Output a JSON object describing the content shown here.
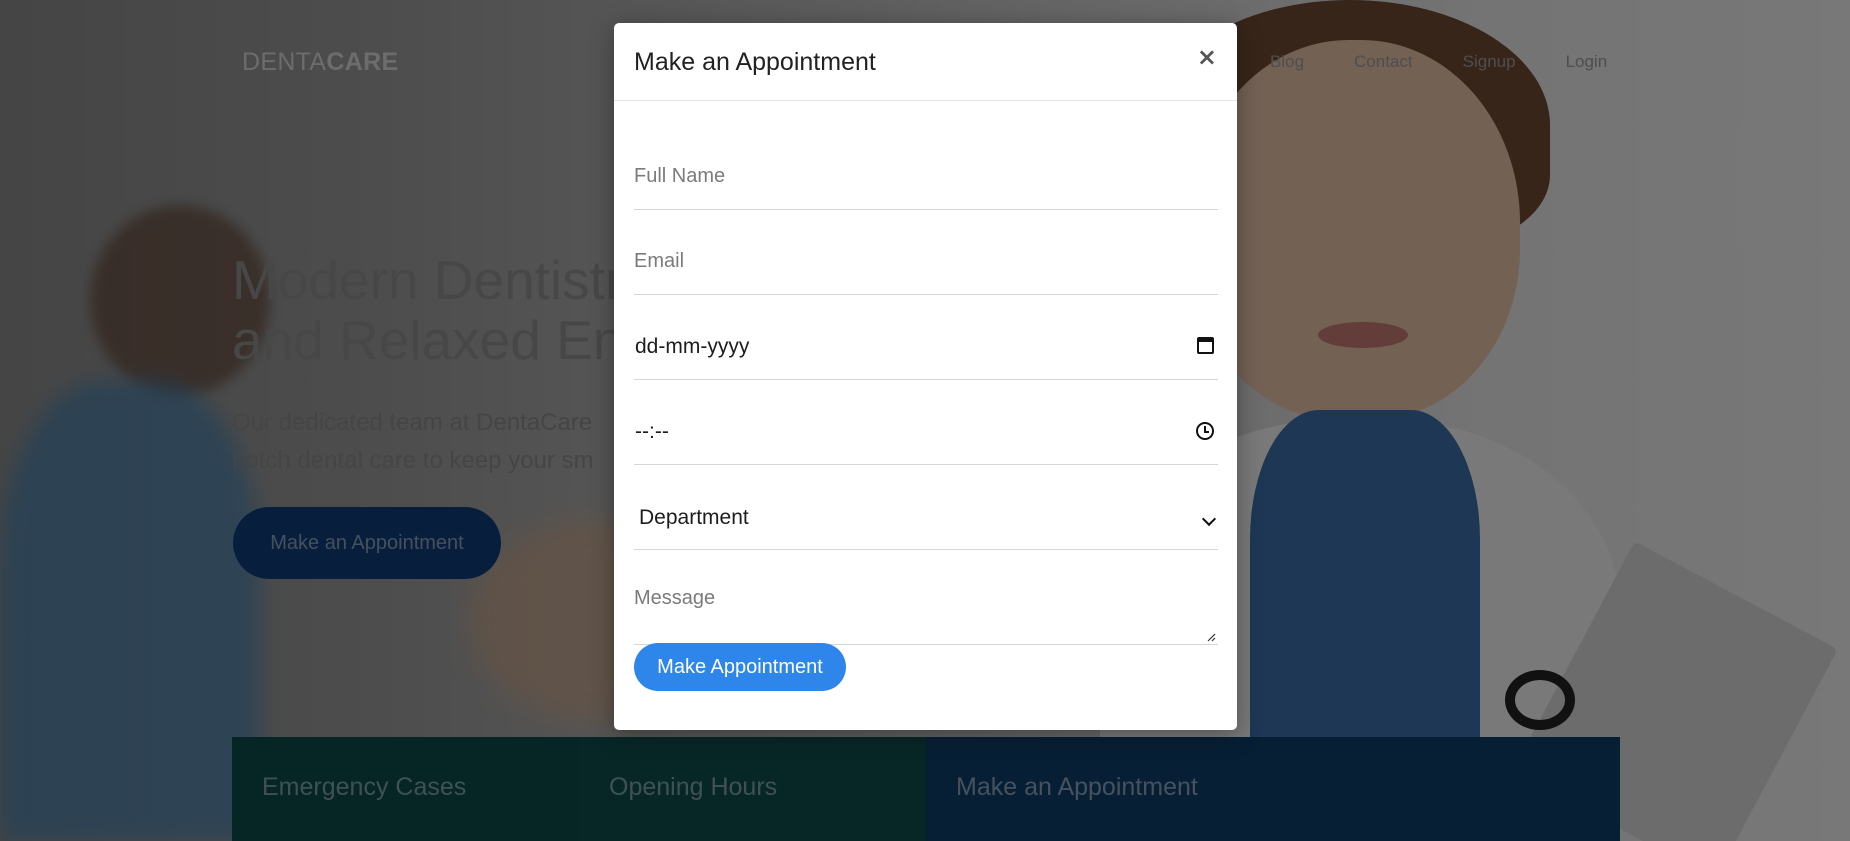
{
  "background": {
    "brand_light": "DENTA",
    "brand_bold": "CARE",
    "nav": [
      "Blog",
      "Contact",
      "Signup",
      "Login"
    ],
    "hero_title_line1": "Modern Dentistr",
    "hero_title_line2": "and Relaxed Env",
    "hero_sub_line1": "Our dedicated team at DentaCare",
    "hero_sub_line2": "notch dental care to keep your sm",
    "hero_button": "Make an Appointment",
    "bands": [
      "Emergency Cases",
      "Opening Hours",
      "Make an Appointment"
    ]
  },
  "modal": {
    "title": "Make an Appointment",
    "close_label": "×",
    "name_placeholder": "Full Name",
    "email_placeholder": "Email",
    "date_value": "dd-mm-yyyy",
    "time_value": "--:--",
    "department_value": "Department",
    "message_placeholder": "Message",
    "submit_label": "Make Appointment"
  },
  "colors": {
    "accent": "#2e86ea",
    "overlay": "rgba(0,0,0,0.5)"
  }
}
